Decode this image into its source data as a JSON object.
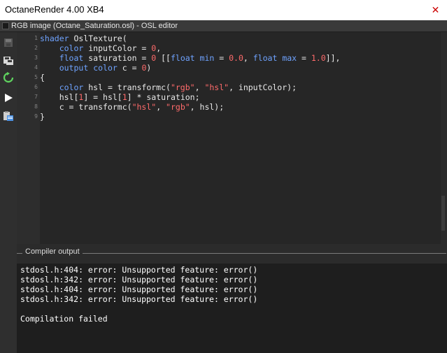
{
  "window": {
    "title": "OctaneRender 4.00 XB4",
    "close_glyph": "✕"
  },
  "panel": {
    "title": "RGB image (Octane_Saturation.osl) - OSL editor"
  },
  "toolbar": {
    "icons": [
      "save-icon",
      "save-as-icon",
      "reload-icon",
      "compile-play-icon",
      "clipboard-icon"
    ]
  },
  "editor": {
    "line_numbers": [
      "1",
      "2",
      "3",
      "4",
      "5",
      "6",
      "7",
      "8",
      "9"
    ],
    "lines": [
      "shader OslTexture(",
      "    color inputColor = 0,",
      "    float saturation = 0 [[float min = 0.0, float max = 1.0]],",
      "    output color c = 0)",
      "{",
      "    color hsl = transformc(\"rgb\", \"hsl\", inputColor);",
      "    hsl[1] = hsl[1] * saturation;",
      "    c = transformc(\"hsl\", \"rgb\", hsl);",
      "}"
    ]
  },
  "compiler": {
    "header": "Compiler output",
    "lines": [
      "stdosl.h:404: error: Unsupported feature: error()",
      "stdosl.h:342: error: Unsupported feature: error()",
      "stdosl.h:404: error: Unsupported feature: error()",
      "stdosl.h:342: error: Unsupported feature: error()",
      "",
      "Compilation failed"
    ]
  },
  "colors": {
    "keyword": "#6fa3ff",
    "literal": "#ff6b6b",
    "text": "#e8e8e8",
    "background": "#262626"
  }
}
